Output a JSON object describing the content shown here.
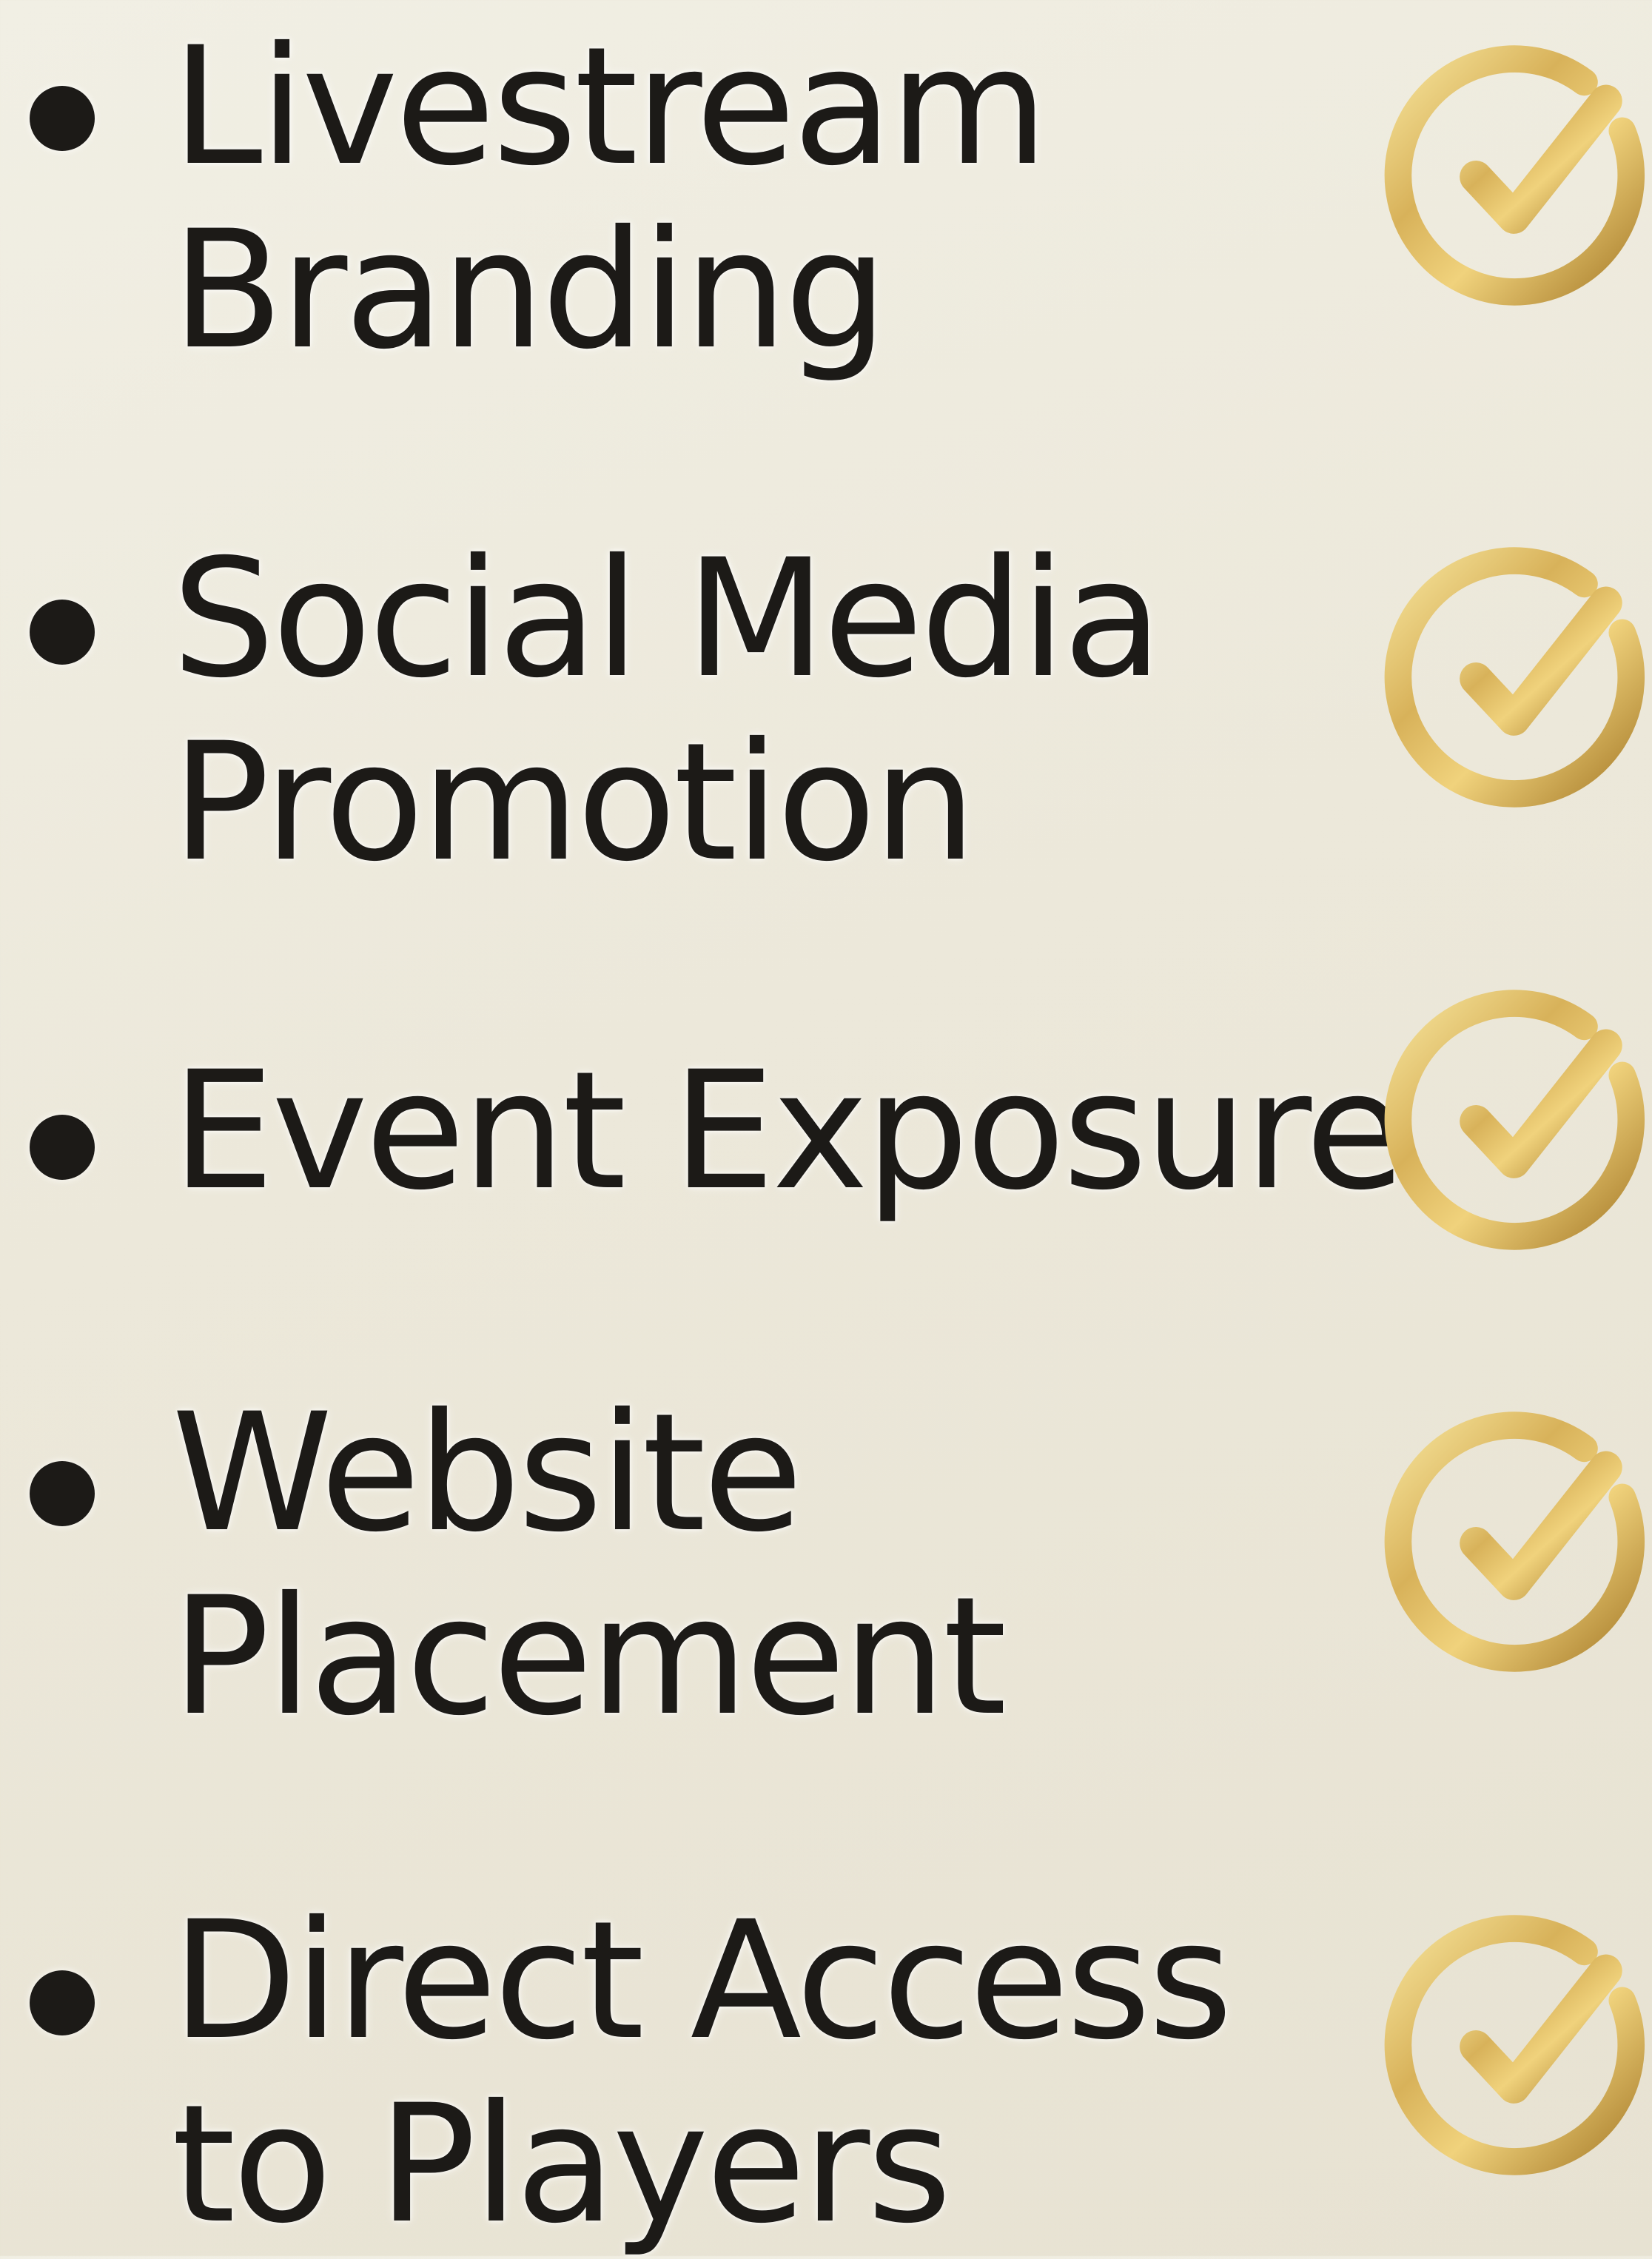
{
  "items": [
    {
      "line1": "Livestream",
      "line2": "Branding",
      "checked": true
    },
    {
      "line1": "Social Media",
      "line2": "Promotion",
      "checked": true
    },
    {
      "line1": "Event Exposure",
      "line2": "",
      "checked": true
    },
    {
      "line1": "Website",
      "line2": "Placement",
      "checked": true
    },
    {
      "line1": "Direct Access",
      "line2": "to Players",
      "checked": true
    }
  ],
  "colors": {
    "text": "#1c1a17",
    "gold_light": "#f3dc8a",
    "gold_mid": "#d4ae52",
    "gold_dark": "#a97e2c",
    "background": "#ece8da"
  },
  "icons": {
    "bullet": "bullet-dot-icon",
    "check": "gold-check-circle-icon"
  }
}
